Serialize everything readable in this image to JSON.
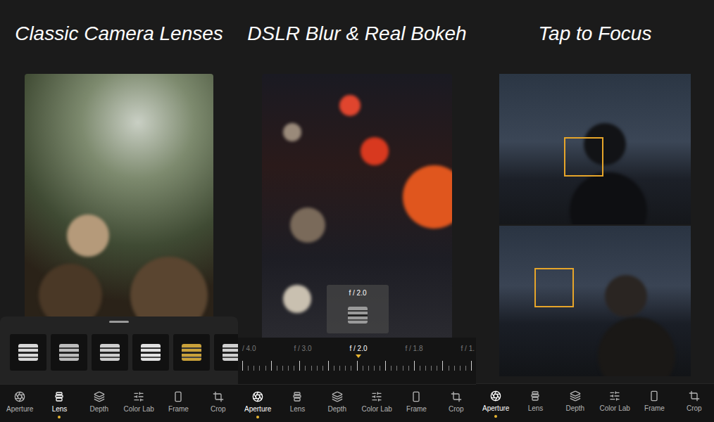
{
  "panels": [
    {
      "kind": "lens",
      "heading": "Classic Camera Lenses",
      "lenses": [
        {
          "color": "#d9d9d9"
        },
        {
          "color": "#bdbdbd"
        },
        {
          "color": "#cfcfcf"
        },
        {
          "color": "#e2e2e2"
        },
        {
          "color": "#c9a13a"
        },
        {
          "color": "#d0d0d0"
        }
      ],
      "nav": [
        {
          "label": "Aperture",
          "selected": false
        },
        {
          "label": "Lens",
          "selected": true
        },
        {
          "label": "Depth",
          "selected": false
        },
        {
          "label": "Color Lab",
          "selected": false
        },
        {
          "label": "Frame",
          "selected": false
        },
        {
          "label": "Crop",
          "selected": false
        }
      ]
    },
    {
      "kind": "aperture",
      "heading": "DSLR Blur & Real Bokeh",
      "overlay": "f / 2.0",
      "stops": [
        {
          "label": "/ 4.0",
          "selected": false
        },
        {
          "label": "f / 3.0",
          "selected": false
        },
        {
          "label": "f / 2.0",
          "selected": true
        },
        {
          "label": "f / 1.8",
          "selected": false
        },
        {
          "label": "f / 1.",
          "selected": false
        }
      ],
      "nav": [
        {
          "label": "Aperture",
          "selected": true
        },
        {
          "label": "Lens",
          "selected": false
        },
        {
          "label": "Depth",
          "selected": false
        },
        {
          "label": "Color Lab",
          "selected": false
        },
        {
          "label": "Frame",
          "selected": false
        },
        {
          "label": "Crop",
          "selected": false
        }
      ]
    },
    {
      "kind": "focus",
      "heading": "Tap to Focus",
      "nav": [
        {
          "label": "Aperture",
          "selected": true
        },
        {
          "label": "Lens",
          "selected": false
        },
        {
          "label": "Depth",
          "selected": false
        },
        {
          "label": "Color Lab",
          "selected": false
        },
        {
          "label": "Frame",
          "selected": false
        },
        {
          "label": "Crop",
          "selected": false
        }
      ]
    }
  ]
}
